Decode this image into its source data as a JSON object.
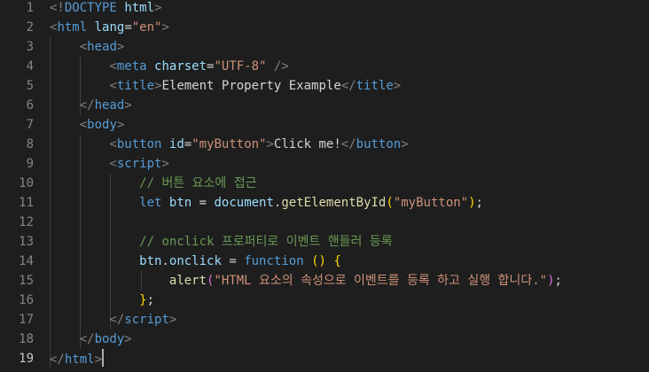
{
  "editor": {
    "line_numbers": [
      "1",
      "2",
      "3",
      "4",
      "5",
      "6",
      "7",
      "8",
      "9",
      "10",
      "11",
      "12",
      "13",
      "14",
      "15",
      "16",
      "17",
      "18",
      "19"
    ],
    "active_line": "19",
    "lines": [
      [
        {
          "t": "<!",
          "c": "t-punc"
        },
        {
          "t": "DOCTYPE",
          "c": "t-tag"
        },
        {
          "t": " ",
          "c": "t-text"
        },
        {
          "t": "html",
          "c": "t-attr"
        },
        {
          "t": ">",
          "c": "t-punc"
        }
      ],
      [
        {
          "t": "<",
          "c": "t-punc"
        },
        {
          "t": "html",
          "c": "t-tag"
        },
        {
          "t": " ",
          "c": "t-text"
        },
        {
          "t": "lang",
          "c": "t-attr"
        },
        {
          "t": "=",
          "c": "t-op"
        },
        {
          "t": "\"en\"",
          "c": "t-str"
        },
        {
          "t": ">",
          "c": "t-punc"
        }
      ],
      [
        {
          "t": "    ",
          "c": "t-text"
        },
        {
          "t": "<",
          "c": "t-punc"
        },
        {
          "t": "head",
          "c": "t-tag"
        },
        {
          "t": ">",
          "c": "t-punc"
        }
      ],
      [
        {
          "t": "        ",
          "c": "t-text"
        },
        {
          "t": "<",
          "c": "t-punc"
        },
        {
          "t": "meta",
          "c": "t-tag"
        },
        {
          "t": " ",
          "c": "t-text"
        },
        {
          "t": "charset",
          "c": "t-attr"
        },
        {
          "t": "=",
          "c": "t-op"
        },
        {
          "t": "\"UTF-8\"",
          "c": "t-str"
        },
        {
          "t": " />",
          "c": "t-punc"
        }
      ],
      [
        {
          "t": "        ",
          "c": "t-text"
        },
        {
          "t": "<",
          "c": "t-punc"
        },
        {
          "t": "title",
          "c": "t-tag"
        },
        {
          "t": ">",
          "c": "t-punc"
        },
        {
          "t": "Element Property Example",
          "c": "t-text"
        },
        {
          "t": "</",
          "c": "t-punc"
        },
        {
          "t": "title",
          "c": "t-tag"
        },
        {
          "t": ">",
          "c": "t-punc"
        }
      ],
      [
        {
          "t": "    ",
          "c": "t-text"
        },
        {
          "t": "</",
          "c": "t-punc"
        },
        {
          "t": "head",
          "c": "t-tag"
        },
        {
          "t": ">",
          "c": "t-punc"
        }
      ],
      [
        {
          "t": "    ",
          "c": "t-text"
        },
        {
          "t": "<",
          "c": "t-punc"
        },
        {
          "t": "body",
          "c": "t-tag"
        },
        {
          "t": ">",
          "c": "t-punc"
        }
      ],
      [
        {
          "t": "        ",
          "c": "t-text"
        },
        {
          "t": "<",
          "c": "t-punc"
        },
        {
          "t": "button",
          "c": "t-tag"
        },
        {
          "t": " ",
          "c": "t-text"
        },
        {
          "t": "id",
          "c": "t-attr"
        },
        {
          "t": "=",
          "c": "t-op"
        },
        {
          "t": "\"myButton\"",
          "c": "t-str"
        },
        {
          "t": ">",
          "c": "t-punc"
        },
        {
          "t": "Click me!",
          "c": "t-text"
        },
        {
          "t": "</",
          "c": "t-punc"
        },
        {
          "t": "button",
          "c": "t-tag"
        },
        {
          "t": ">",
          "c": "t-punc"
        }
      ],
      [
        {
          "t": "        ",
          "c": "t-text"
        },
        {
          "t": "<",
          "c": "t-punc"
        },
        {
          "t": "script",
          "c": "t-tag"
        },
        {
          "t": ">",
          "c": "t-punc"
        }
      ],
      [
        {
          "t": "            ",
          "c": "t-text"
        },
        {
          "t": "// 버튼 요소에 접근",
          "c": "t-cmt"
        }
      ],
      [
        {
          "t": "            ",
          "c": "t-text"
        },
        {
          "t": "let",
          "c": "t-kw"
        },
        {
          "t": " ",
          "c": "t-text"
        },
        {
          "t": "btn",
          "c": "t-var"
        },
        {
          "t": " = ",
          "c": "t-op"
        },
        {
          "t": "document",
          "c": "t-var"
        },
        {
          "t": ".",
          "c": "t-op"
        },
        {
          "t": "getElementById",
          "c": "t-fn"
        },
        {
          "t": "(",
          "c": "t-brk1"
        },
        {
          "t": "\"myButton\"",
          "c": "t-str"
        },
        {
          "t": ")",
          "c": "t-brk1"
        },
        {
          "t": ";",
          "c": "t-op"
        }
      ],
      [],
      [
        {
          "t": "            ",
          "c": "t-text"
        },
        {
          "t": "// onclick 프로퍼티로 이벤트 핸들러 등록",
          "c": "t-cmt"
        }
      ],
      [
        {
          "t": "            ",
          "c": "t-text"
        },
        {
          "t": "btn",
          "c": "t-var"
        },
        {
          "t": ".",
          "c": "t-op"
        },
        {
          "t": "onclick",
          "c": "t-var"
        },
        {
          "t": " = ",
          "c": "t-op"
        },
        {
          "t": "function",
          "c": "t-kw"
        },
        {
          "t": " ",
          "c": "t-text"
        },
        {
          "t": "()",
          "c": "t-brk1"
        },
        {
          "t": " ",
          "c": "t-text"
        },
        {
          "t": "{",
          "c": "t-brk1"
        }
      ],
      [
        {
          "t": "                ",
          "c": "t-text"
        },
        {
          "t": "alert",
          "c": "t-fn"
        },
        {
          "t": "(",
          "c": "t-brk2"
        },
        {
          "t": "\"HTML 요소의 속성으로 이벤트를 등록 하고 실행 합니다.\"",
          "c": "t-str"
        },
        {
          "t": ")",
          "c": "t-brk2"
        },
        {
          "t": ";",
          "c": "t-op"
        }
      ],
      [
        {
          "t": "            ",
          "c": "t-text"
        },
        {
          "t": "}",
          "c": "t-brk1"
        },
        {
          "t": ";",
          "c": "t-op"
        }
      ],
      [
        {
          "t": "        ",
          "c": "t-text"
        },
        {
          "t": "</",
          "c": "t-punc"
        },
        {
          "t": "script",
          "c": "t-tag"
        },
        {
          "t": ">",
          "c": "t-punc"
        }
      ],
      [
        {
          "t": "    ",
          "c": "t-text"
        },
        {
          "t": "</",
          "c": "t-punc"
        },
        {
          "t": "body",
          "c": "t-tag"
        },
        {
          "t": ">",
          "c": "t-punc"
        }
      ],
      [
        {
          "t": "</",
          "c": "t-punc"
        },
        {
          "t": "html",
          "c": "t-tag"
        },
        {
          "t": ">",
          "c": "t-punc"
        }
      ]
    ]
  }
}
